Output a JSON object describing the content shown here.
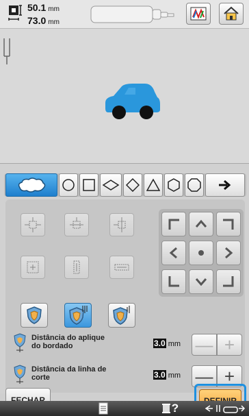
{
  "header": {
    "size_width": "50.1",
    "size_height": "73.0",
    "unit": "mm",
    "icons": [
      "embroidery-size-icon",
      "thread-color-icon",
      "home-icon"
    ]
  },
  "shape_tabs": {
    "items": [
      "cloud-shape",
      "circle",
      "square",
      "diamond-wide",
      "diamond",
      "triangle",
      "hexagon",
      "octagon",
      "next-arrow"
    ],
    "selected": "cloud-shape"
  },
  "settings": {
    "distance_applique_label": "Distância do aplique do bordado",
    "distance_applique_value": "3.0",
    "distance_cutline_label": "Distância da linha de corte",
    "distance_cutline_value": "3.0",
    "unit": "mm",
    "minus_symbol": "—",
    "plus_symbol": "+"
  },
  "buttons": {
    "close": "FECHAR",
    "define": "DEFINIR"
  },
  "bottombar": {
    "help_label": "?"
  },
  "colors": {
    "accent_blue": "#1e90e0",
    "define_orange": "#f2a23a",
    "car_blue": "#2a97dc"
  }
}
